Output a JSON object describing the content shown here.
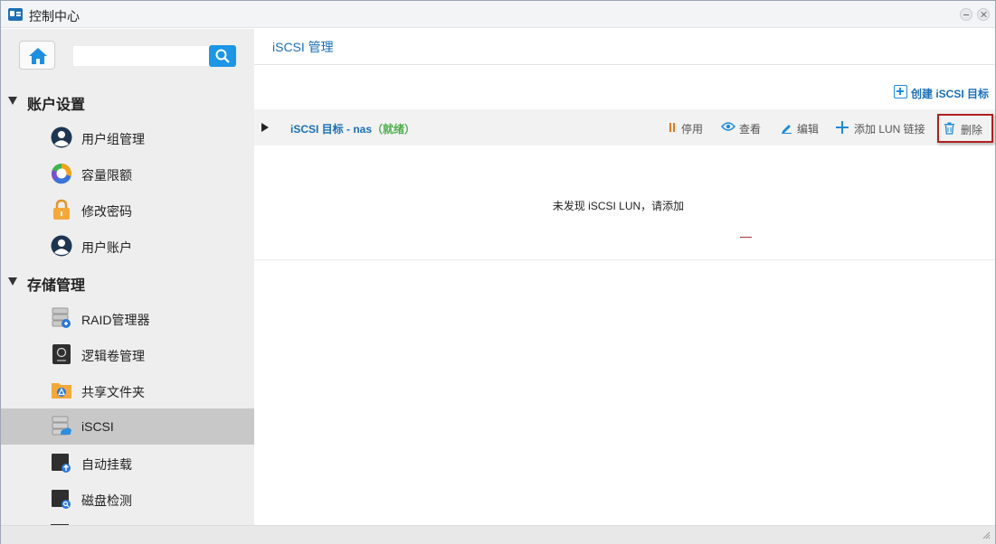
{
  "window": {
    "title": "控制中心",
    "icon": "control-panel-icon"
  },
  "sidebar": {
    "search": {
      "value": "",
      "placeholder": ""
    },
    "sections": [
      {
        "label": "账户设置",
        "items": [
          {
            "label": "用户组管理",
            "icon": "user-group-icon"
          },
          {
            "label": "容量限额",
            "icon": "quota-pie-icon"
          },
          {
            "label": "修改密码",
            "icon": "lock-icon"
          },
          {
            "label": "用户账户",
            "icon": "user-account-icon"
          }
        ]
      },
      {
        "label": "存储管理",
        "items": [
          {
            "label": "RAID管理器",
            "icon": "raid-icon"
          },
          {
            "label": "逻辑卷管理",
            "icon": "lvm-icon"
          },
          {
            "label": "共享文件夹",
            "icon": "shared-folder-icon"
          },
          {
            "label": "iSCSI",
            "icon": "iscsi-icon",
            "active": true
          },
          {
            "label": "自动挂载",
            "icon": "automount-icon"
          },
          {
            "label": "磁盘检测",
            "icon": "disk-check-icon"
          }
        ]
      }
    ]
  },
  "main": {
    "title": "iSCSI 管理",
    "create_label": "创建 iSCSI 目标",
    "target": {
      "name": "iSCSI 目标 - nas",
      "status": "（就绪）"
    },
    "actions": {
      "stop": "停用",
      "view": "查看",
      "edit": "编辑",
      "add_lun": "添加 LUN 链接",
      "delete": "删除"
    },
    "empty_message": "未发现 iSCSI LUN，请添加"
  },
  "colors": {
    "accent": "#1a6fb8",
    "search_button": "#1e96e6",
    "ready_status": "#4cae4c",
    "highlight_border": "#b02020",
    "stop_icon": "#e07a1f"
  }
}
